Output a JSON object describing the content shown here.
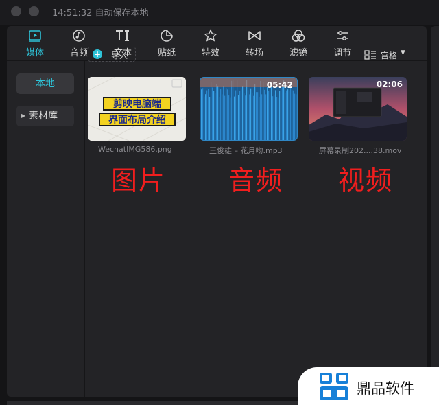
{
  "titlebar": {
    "text": "14:51:32 自动保存本地"
  },
  "toolbar": {
    "tabs": [
      {
        "label": "媒体",
        "icon": "media-play-icon",
        "active": true
      },
      {
        "label": "音频",
        "icon": "music-note-icon"
      },
      {
        "label": "文本",
        "icon": "text-ti-icon"
      },
      {
        "label": "贴纸",
        "icon": "sticker-icon"
      },
      {
        "label": "特效",
        "icon": "star-effects-icon"
      },
      {
        "label": "转场",
        "icon": "bowtie-transition-icon"
      },
      {
        "label": "滤镜",
        "icon": "filter-circles-icon"
      },
      {
        "label": "调节",
        "icon": "sliders-adjust-icon"
      }
    ]
  },
  "sidebar": {
    "local_label": "本地",
    "library_label": "素材库"
  },
  "main": {
    "import_label": "导入",
    "view_label": "宫格",
    "media": [
      {
        "filename": "WechatIMG586.png",
        "type": "image",
        "thumb_text_line1": "剪映电脑端",
        "thumb_text_line2": "界面布局介绍"
      },
      {
        "filename": "王俊雄 – 花月吻.mp3",
        "type": "audio",
        "duration": "05:42"
      },
      {
        "filename": "屏幕录制202....38.mov",
        "type": "video",
        "duration": "02:06"
      }
    ],
    "annotations": [
      "图片",
      "音频",
      "视频"
    ]
  },
  "brand": {
    "text": "鼎品软件"
  },
  "colors": {
    "accent": "#2ec3d8",
    "annotation": "#f01e1e",
    "panel": "#232326",
    "background": "#141416"
  }
}
